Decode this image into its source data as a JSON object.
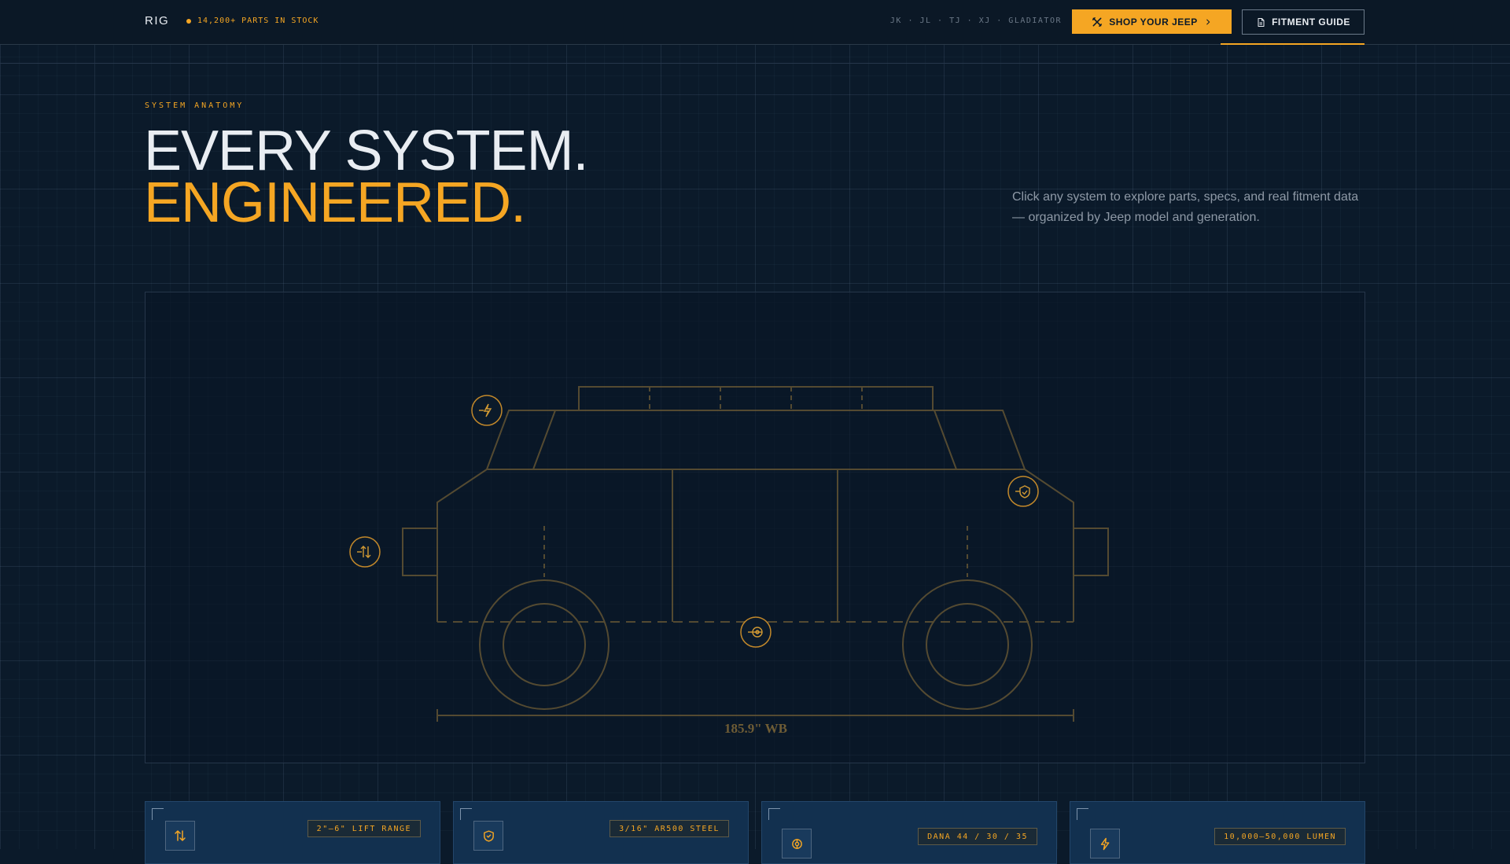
{
  "header": {
    "logo": "RIG",
    "stock_status": "14,200+ PARTS IN STOCK",
    "models": "JK · JL · TJ · XJ · GLADIATOR",
    "shop_button_label": "SHOP YOUR JEEP",
    "fitment_button_label": "FITMENT GUIDE"
  },
  "hero": {
    "eyebrow": "SYSTEM ANATOMY",
    "title_line1": "EVERY SYSTEM.",
    "title_line2": "ENGINEERED.",
    "description": "Click any system to explore parts, specs, and real fitment data — organized by Jeep model and generation."
  },
  "blueprint": {
    "wheelbase_label": "185.9\" WB",
    "hotspots": [
      {
        "name": "lighting",
        "icon": "bolt-icon"
      },
      {
        "name": "armor",
        "icon": "shield-icon"
      },
      {
        "name": "suspension",
        "icon": "up-down-arrows-icon"
      },
      {
        "name": "axles",
        "icon": "gear-icon"
      }
    ]
  },
  "cards": [
    {
      "icon": "up-down-arrows-icon",
      "tag": "2\"–6\" LIFT RANGE"
    },
    {
      "icon": "shield-icon",
      "tag": "3/16\" AR500 STEEL"
    },
    {
      "icon": "gear-icon",
      "tag": "DANA 44 / 30 / 35"
    },
    {
      "icon": "bolt-icon",
      "tag": "10,000–50,000 LUMEN"
    }
  ],
  "colors": {
    "background": "#0b1a2a",
    "accent": "#f5a623",
    "card_bg": "#12304f",
    "muted_text": "#8e99a6"
  }
}
